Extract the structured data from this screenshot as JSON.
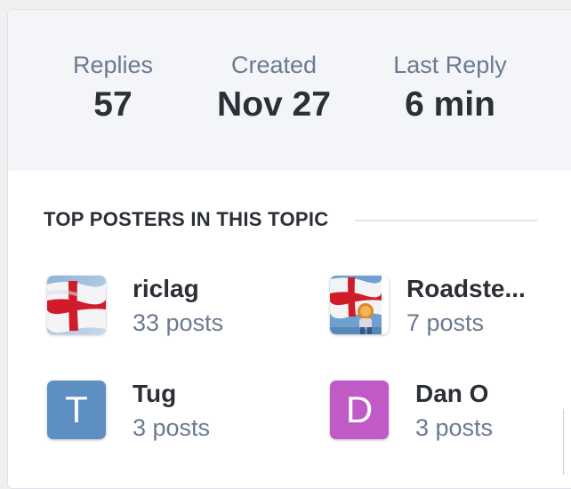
{
  "stats": {
    "replies_label": "Replies",
    "replies_value": "57",
    "created_label": "Created",
    "created_value": "Nov 27",
    "last_reply_label": "Last Reply",
    "last_reply_value": "6 min"
  },
  "top_posters": {
    "heading": "TOP POSTERS IN THIS TOPIC",
    "items": [
      {
        "name": "riclag",
        "posts": "33 posts",
        "avatar": "england-flag-image"
      },
      {
        "name": "Roadste...",
        "posts": "7 posts",
        "avatar": "england-flag-lion-image"
      },
      {
        "name": "Tug",
        "posts": "3 posts",
        "avatar_letter": "T",
        "avatar_color": "#5d8fc2"
      },
      {
        "name": "Dan O",
        "posts": "3 posts",
        "avatar_letter": "D",
        "avatar_color": "#c05ac5"
      }
    ]
  },
  "colors": {
    "stats_band": "#f3f5f8",
    "muted_text": "#6b7a90",
    "strong_text": "#2b2f36"
  }
}
